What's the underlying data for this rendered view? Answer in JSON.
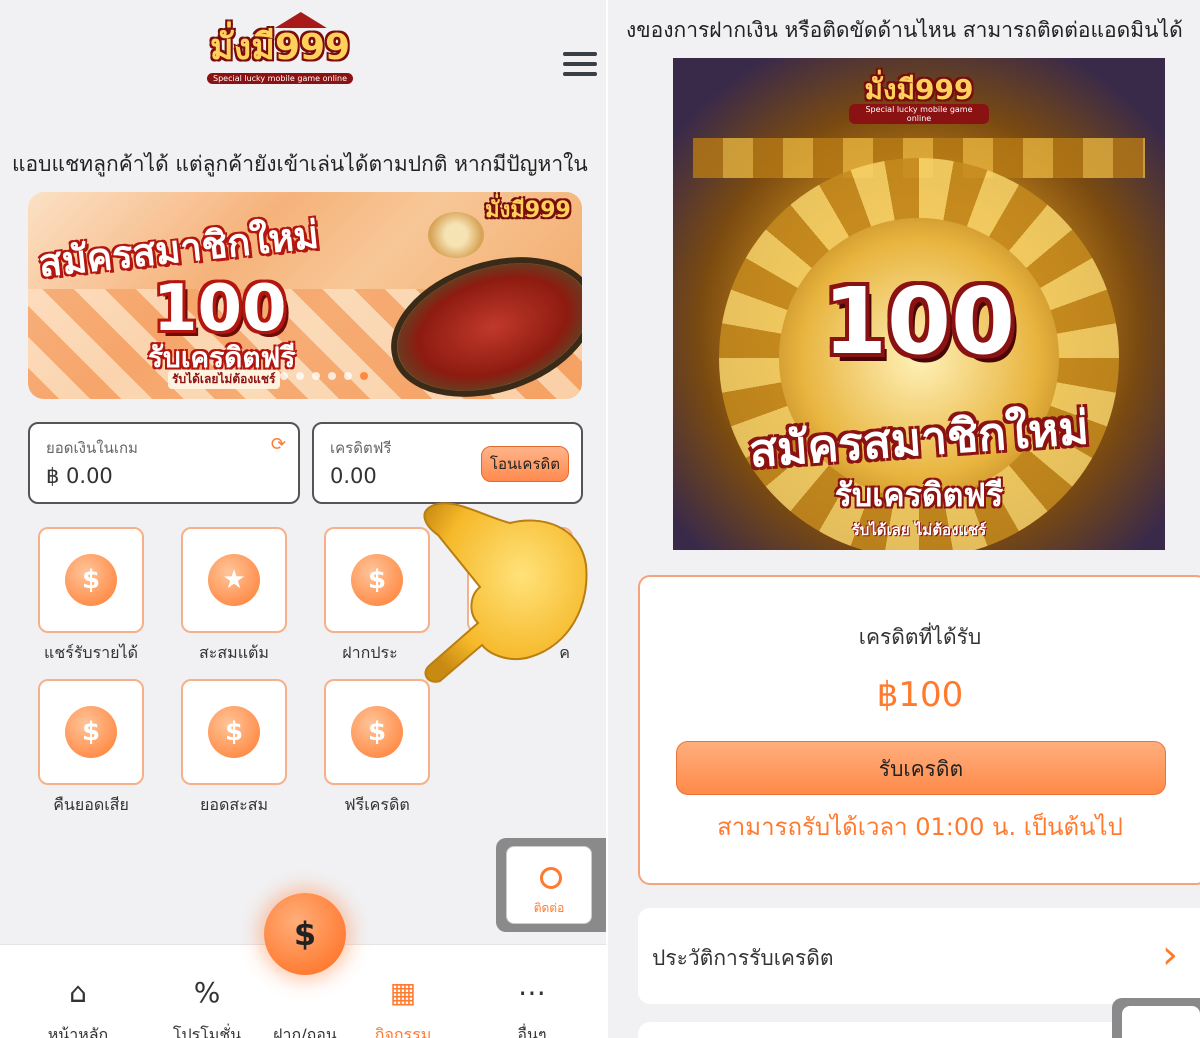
{
  "left": {
    "logo": {
      "main": "มั่งมี999",
      "sub": "Special lucky mobile game online"
    },
    "marquee": "แอบแชทลูกค้าได้ แต่ลูกค้ายังเข้าเล่นได้ตามปกติ หากมีปัญหาใน",
    "banner": {
      "title": "สมัครสมาชิกใหม่",
      "amount": "100",
      "free": "รับเครดิตฟรี",
      "small": "รับได้เลยไม่ต้องแชร์",
      "logo": "มั่งมี999"
    },
    "balance": {
      "label": "ยอดเงินในเกม",
      "value": "฿ 0.00",
      "refresh_icon": "refresh-icon"
    },
    "free_credit": {
      "label": "เครดิตฟรี",
      "value": "0.00",
      "button": "โอนเครดิต"
    },
    "menu": [
      {
        "label": "แชร์รับรายได้",
        "icon": "coins-hand-icon",
        "glyph": "$"
      },
      {
        "label": "สะสมแต้ม",
        "icon": "star-icon",
        "glyph": "★"
      },
      {
        "label": "ฝากประ",
        "icon": "piggy-bank-icon",
        "glyph": "$"
      },
      {
        "label": "ค",
        "icon": "partial-icon",
        "glyph": ""
      },
      {
        "label": "คืนยอดเสีย",
        "icon": "cashback-icon",
        "glyph": "$"
      },
      {
        "label": "ยอดสะสม",
        "icon": "money-bag-icon",
        "glyph": "$"
      },
      {
        "label": "ฟรีเครดิต",
        "icon": "coin-stack-icon",
        "glyph": "$"
      }
    ],
    "contact": "ติดต่อ",
    "nav": [
      {
        "label": "หน้าหลัก",
        "icon": "⌂"
      },
      {
        "label": "โปรโมชั่น",
        "icon": "%"
      },
      {
        "label": "ฝาก/ถอน",
        "icon": ""
      },
      {
        "label": "กิจกรรม",
        "icon": "▦"
      },
      {
        "label": "อื่นๆ",
        "icon": "⋯"
      }
    ],
    "fab_icon": "$"
  },
  "right": {
    "marquee": "งของการฝากเงิน หรือติดขัดด้านไหน สามารถติดต่อแอดมินได้",
    "banner": {
      "logo": "มั่งมี999",
      "logo_sub": "Special lucky mobile game online",
      "amount": "100",
      "title": "สมัครสมาชิกใหม่",
      "free": "รับเครดิตฟรี",
      "small": "รับได้เลย ไม่ต้องแชร์"
    },
    "credit": {
      "title": "เครดิตที่ได้รับ",
      "amount": "฿100",
      "button": "รับเครดิต",
      "note": "สามารถรับได้เวลา 01:00 น. เป็นต้นไป"
    },
    "history": {
      "label": "ประวัติการรับเครดิต",
      "chevron": "›"
    }
  },
  "colors": {
    "accent": "#ff7a2e",
    "tile_border": "#f6b08a",
    "background": "#f1f1f3"
  }
}
